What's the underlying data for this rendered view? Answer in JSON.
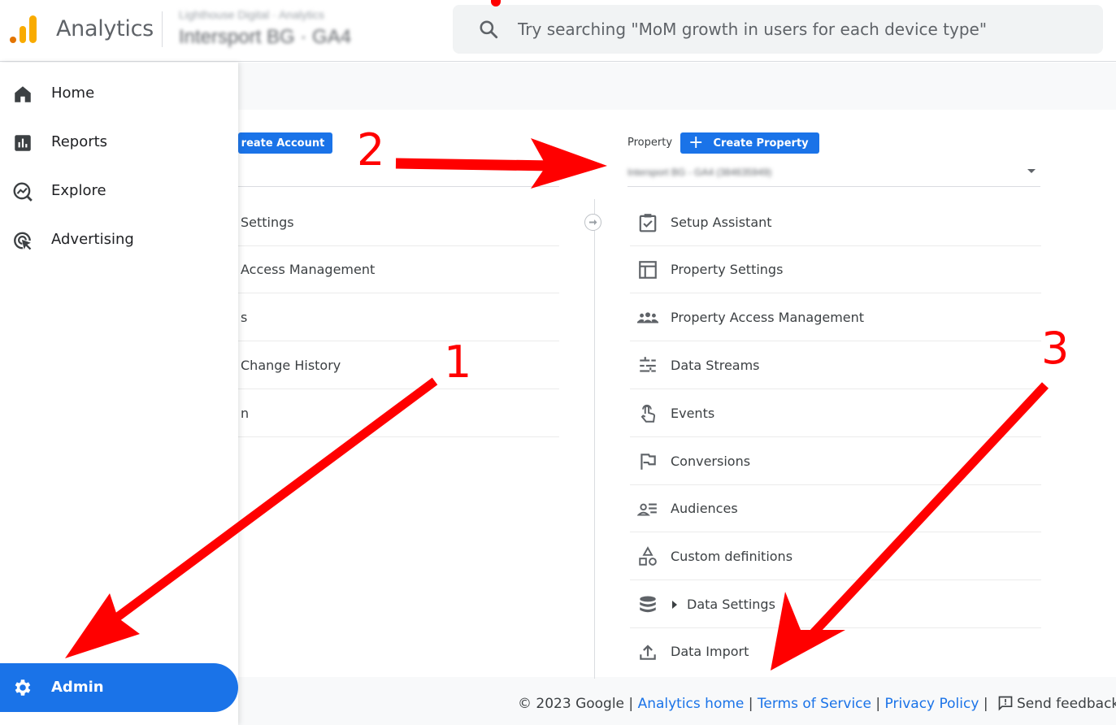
{
  "app": {
    "title": "Analytics",
    "account_line1": "Lighthouse Digital · Analytics",
    "account_line2": "Intersport BG · GA4"
  },
  "search": {
    "placeholder": "Try searching \"MoM growth in users for each device type\""
  },
  "nav": {
    "items": [
      {
        "label": "Home",
        "icon": "home-icon"
      },
      {
        "label": "Reports",
        "icon": "reports-icon"
      },
      {
        "label": "Explore",
        "icon": "explore-icon"
      },
      {
        "label": "Advertising",
        "icon": "advertising-icon"
      }
    ],
    "admin": {
      "label": "Admin",
      "icon": "gear-icon"
    }
  },
  "account_column": {
    "create_label": "reate Account",
    "items": [
      "Settings",
      "Access Management",
      "s",
      "Change History",
      "n"
    ]
  },
  "property_column": {
    "label": "Property",
    "create_label": "Create Property",
    "selected_property": "Intersport BG - GA4 (384635949)",
    "items": [
      {
        "label": "Setup Assistant",
        "icon": "checklist-icon"
      },
      {
        "label": "Property Settings",
        "icon": "property-settings-icon"
      },
      {
        "label": "Property Access Management",
        "icon": "people-icon"
      },
      {
        "label": "Data Streams",
        "icon": "data-streams-icon"
      },
      {
        "label": "Events",
        "icon": "touch-icon"
      },
      {
        "label": "Conversions",
        "icon": "flag-icon"
      },
      {
        "label": "Audiences",
        "icon": "audiences-icon"
      },
      {
        "label": "Custom definitions",
        "icon": "shapes-icon"
      },
      {
        "label": "Data Settings",
        "icon": "database-icon"
      },
      {
        "label": "Data Import",
        "icon": "upload-icon"
      }
    ]
  },
  "footer": {
    "copyright": "© 2023 Google |",
    "analytics_home": "Analytics home",
    "sep1": "|",
    "terms": "Terms of Service",
    "sep2": "|",
    "privacy": "Privacy Policy",
    "sep3": "|",
    "feedback": "Send feedback"
  },
  "annotations": [
    "1",
    "2",
    "3"
  ],
  "colors": {
    "accent": "#1a73e8",
    "annotation": "#ff0000",
    "logo_orange": "#f9ab00",
    "logo_dark_orange": "#e37400"
  }
}
